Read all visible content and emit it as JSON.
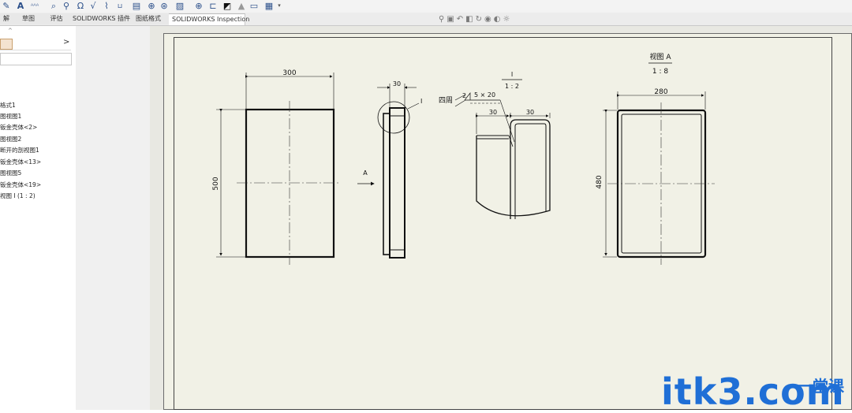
{
  "toolbar": {
    "icons": [
      "sheet-metal-icon",
      "annotation-text-icon",
      "note-icon",
      "find-icon",
      "zoom-icon",
      "balloon-icon",
      "weld-symbol-icon",
      "surface-finish-icon",
      "datum-icon",
      "table-icon",
      "block-icon",
      "center-mark-icon",
      "hatch-icon",
      "layer-icon",
      "view-icon",
      "grid-icon"
    ]
  },
  "tabs": [
    {
      "label": "解"
    },
    {
      "label": "草图"
    },
    {
      "label": "评估"
    },
    {
      "label": "SOLIDWORKS 插件"
    },
    {
      "label": "图纸格式"
    },
    {
      "label": "SOLIDWORKS Inspection"
    }
  ],
  "left_panel": {
    "top_label": "^",
    "chevron": ">",
    "tree_items": [
      "格式1",
      "图视图1",
      "钣金壳体<2>",
      "图视图2",
      "断开的剖视图1",
      "钣金壳体<13>",
      "图视图5",
      "钣金壳体<19>",
      "视图 I (1 : 2)"
    ]
  },
  "drawing": {
    "view1": {
      "dim_top": "300",
      "dim_left": "500"
    },
    "view2": {
      "dim_top": "30",
      "callout": "I",
      "arrow_label": "A"
    },
    "detail": {
      "scale_top": "I",
      "scale_bottom": "1 : 2",
      "weld_text": "四周",
      "weld_symbol": "2",
      "weld_spec": "5 × 20",
      "dim_a": "30",
      "dim_b": "30"
    },
    "view_a": {
      "title": "视图 A",
      "scale": "1 : 8",
      "dim_top": "280",
      "dim_left": "480"
    }
  },
  "watermark": {
    "main": "itk3.com",
    "sub": "一堂课"
  }
}
